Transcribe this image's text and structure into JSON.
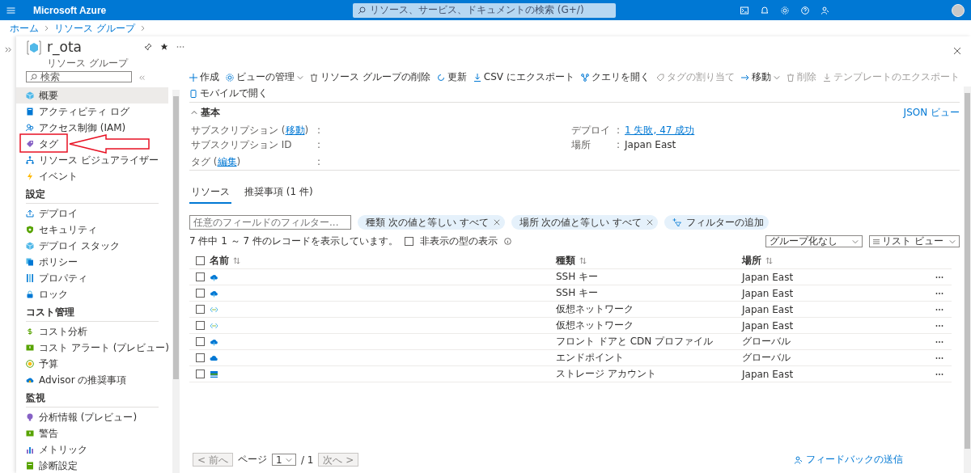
{
  "topbar": {
    "brand": "Microsoft Azure",
    "search_placeholder": "リソース、サービス、ドキュメントの検索 (G+/)"
  },
  "breadcrumb": [
    "ホーム",
    "リソース グループ"
  ],
  "resource": {
    "title": "r_ota",
    "subtitle": "リソース グループ"
  },
  "sidebar": {
    "search_placeholder": "検索",
    "sections": [
      {
        "items": [
          {
            "label": "概要",
            "kind": "cube",
            "selected": true
          },
          {
            "label": "アクティビティ ログ",
            "kind": "book",
            "selected": false
          },
          {
            "label": "アクセス制御 (IAM)",
            "kind": "people",
            "selected": false
          },
          {
            "label": "タグ",
            "kind": "tag",
            "selected": false
          },
          {
            "label": "リソース ビジュアライザー",
            "kind": "tree",
            "selected": false
          },
          {
            "label": "イベント",
            "kind": "bolt",
            "selected": false
          }
        ]
      },
      {
        "heading": "設定",
        "items": [
          {
            "label": "デプロイ",
            "kind": "upload",
            "selected": false
          },
          {
            "label": "セキュリティ",
            "kind": "shield",
            "selected": false
          },
          {
            "label": "デプロイ スタック",
            "kind": "cube",
            "selected": false
          },
          {
            "label": "ポリシー",
            "kind": "pages",
            "selected": false
          },
          {
            "label": "プロパティ",
            "kind": "bars",
            "selected": false
          },
          {
            "label": "ロック",
            "kind": "lock",
            "selected": false
          }
        ]
      },
      {
        "heading": "コスト管理",
        "items": [
          {
            "label": "コスト分析",
            "kind": "dollar",
            "selected": false
          },
          {
            "label": "コスト アラート (プレビュー)",
            "kind": "alert",
            "selected": false
          },
          {
            "label": "予算",
            "kind": "coin",
            "selected": false
          },
          {
            "label": "Advisor の推奨事項",
            "kind": "cloud",
            "selected": false
          }
        ]
      },
      {
        "heading": "監視",
        "items": [
          {
            "label": "分析情報 (プレビュー)",
            "kind": "bulb",
            "selected": false
          },
          {
            "label": "警告",
            "kind": "alert",
            "selected": false
          },
          {
            "label": "メトリック",
            "kind": "chart",
            "selected": false
          },
          {
            "label": "診断設定",
            "kind": "doc",
            "selected": false
          }
        ]
      }
    ]
  },
  "toolbar": [
    {
      "label": "作成",
      "kind": "plus",
      "disabled": false
    },
    {
      "label": "ビューの管理",
      "kind": "gear",
      "disabled": false,
      "dropdown": true
    },
    {
      "label": "リソース グループの削除",
      "kind": "trash",
      "disabled": false
    },
    {
      "label": "更新",
      "kind": "refresh",
      "disabled": false
    },
    {
      "label": "CSV にエクスポート",
      "kind": "download",
      "disabled": false
    },
    {
      "label": "クエリを開く",
      "kind": "query",
      "disabled": false
    },
    {
      "label": "タグの割り当て",
      "kind": "tag",
      "disabled": true
    },
    {
      "label": "移動",
      "kind": "arrow",
      "disabled": false,
      "dropdown": true
    },
    {
      "label": "削除",
      "kind": "trash",
      "disabled": true
    },
    {
      "label": "テンプレートのエクスポート",
      "kind": "download",
      "disabled": true
    },
    {
      "label": "モバイルで開く",
      "kind": "phone",
      "disabled": false
    }
  ],
  "essentials": {
    "heading": "基本",
    "json_link": "JSON ビュー",
    "left": [
      {
        "label": "サブスクリプション (",
        "link": "移動",
        "suffix": ")",
        "sep": ":"
      },
      {
        "label": "サブスクリプション ID",
        "sep": ":"
      },
      {
        "label": "タグ (",
        "link": "編集",
        "suffix": ")",
        "sep": ":"
      }
    ],
    "right": [
      {
        "label": "デプロイ",
        "sep": ":",
        "value_link": "1 失敗, 47 成功"
      },
      {
        "label": "場所",
        "sep": ":",
        "value": "Japan East"
      }
    ]
  },
  "tabs": [
    {
      "label": "リソース",
      "selected": true
    },
    {
      "label": "推奨事項 (1 件)",
      "selected": false
    }
  ],
  "filter": {
    "placeholder": "任意のフィールドのフィルター...",
    "pills": [
      "種類 次の値と等しい すべて",
      "場所 次の値と等しい すべて"
    ],
    "add": "フィルターの追加"
  },
  "summary": {
    "text": "7 件中 1 ～ 7 件のレコードを表示しています。",
    "hidden_types": {
      "label": "非表示の型の表示",
      "checked": false
    }
  },
  "dropdowns": [
    "グループ化なし",
    "リスト ビュー"
  ],
  "table": {
    "columns": [
      "名前",
      "種類",
      "場所"
    ],
    "select_all_checked": false,
    "rows": [
      {
        "kind": "cloud",
        "type": "SSH キー",
        "location": "Japan East",
        "checked": false
      },
      {
        "kind": "cloud",
        "type": "SSH キー",
        "location": "Japan East",
        "checked": false
      },
      {
        "kind": "network",
        "type": "仮想ネットワーク",
        "location": "Japan East",
        "checked": false
      },
      {
        "kind": "network",
        "type": "仮想ネットワーク",
        "location": "Japan East",
        "checked": false
      },
      {
        "kind": "cloud",
        "type": "フロント ドアと CDN プロファイル",
        "location": "グローバル",
        "checked": false
      },
      {
        "kind": "flatcloud",
        "type": "エンドポイント",
        "location": "グローバル",
        "checked": false
      },
      {
        "kind": "storage",
        "type": "ストレージ アカウント",
        "location": "Japan East",
        "checked": false
      }
    ]
  },
  "pagination": {
    "prev": "< 前へ",
    "page_label": "ページ",
    "page": "1",
    "total": "/ 1",
    "next": "次へ >"
  },
  "feedback": "フィードバックの送信"
}
